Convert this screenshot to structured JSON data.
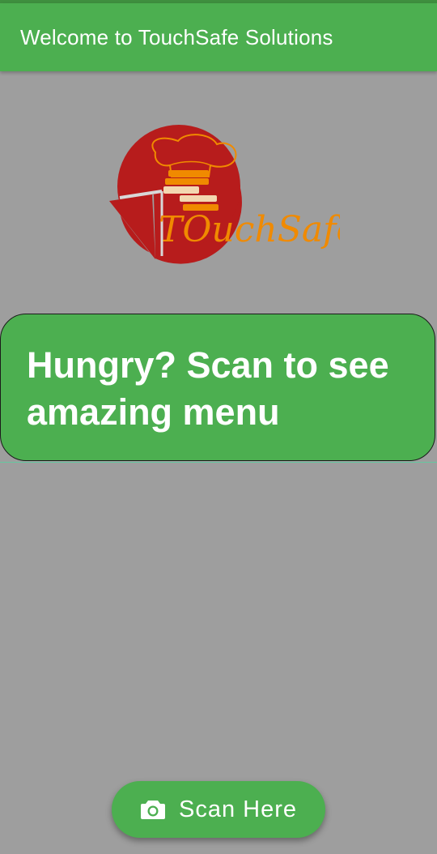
{
  "app_bar": {
    "title": "Welcome to TouchSafe Solutions"
  },
  "logo": {
    "wordmark": "TOuchSafe",
    "icon": "chef-hat-burger-pizza-logo"
  },
  "promo": {
    "text": "Hungry? Scan to see amazing menu"
  },
  "scan_button": {
    "label": "Scan Here",
    "icon": "camera-icon"
  },
  "colors": {
    "primary": "#4caf50",
    "background": "#9e9e9e",
    "logo_red": "#b71c1c",
    "logo_orange": "#f08a00"
  }
}
